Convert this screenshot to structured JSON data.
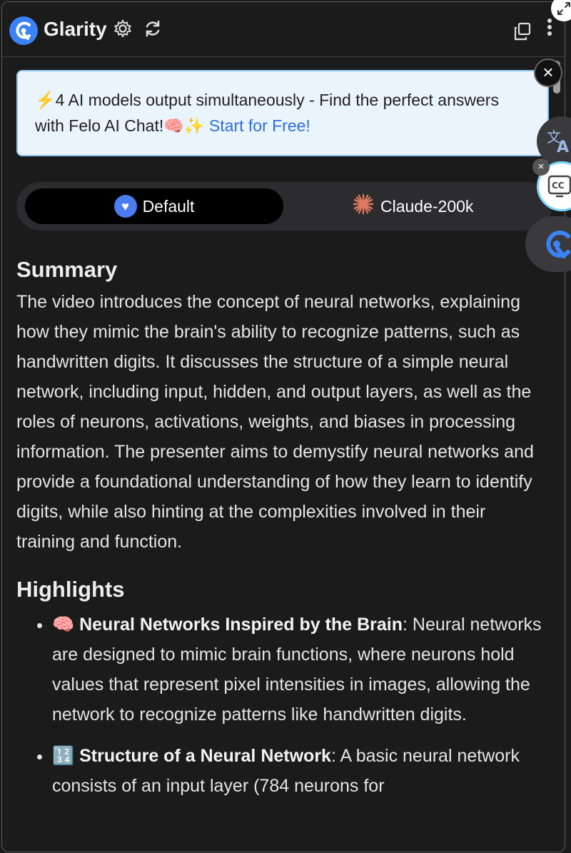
{
  "header": {
    "brand": "Glarity",
    "icons": [
      "glarity-logo-icon",
      "settings-gear-icon",
      "refresh-icon",
      "copy-icon",
      "more-vertical-icon"
    ]
  },
  "banner": {
    "text": "⚡4 AI models output simultaneously - Find the perfect answers with Felo AI Chat!🧠✨ ",
    "link": "Start for Free!"
  },
  "close_label": "×",
  "models": {
    "default_label": "Default",
    "claude_label": "Claude-200k",
    "selected": "Default"
  },
  "summary": {
    "title": "Summary",
    "text": "The video introduces the concept of neural networks, explaining how they mimic the brain's ability to recognize patterns, such as handwritten digits. It discusses the structure of a simple neural network, including input, hidden, and output layers, as well as the roles of neurons, activations, weights, and biases in processing information. The presenter aims to demystify neural networks and provide a foundational understanding of how they learn to identify digits, while also hinting at the complexities involved in their training and function."
  },
  "highlights": {
    "title": "Highlights",
    "items": [
      {
        "emoji": "🧠",
        "title": "Neural Networks Inspired by the Brain",
        "text": ": Neural networks are designed to mimic brain functions, where neurons hold values that represent pixel intensities in images, allowing the network to recognize patterns like handwritten digits."
      },
      {
        "emoji": "🔢",
        "title": "Structure of a Neural Network",
        "text": ": A basic neural network consists of an input layer (784 neurons for"
      }
    ]
  },
  "side_buttons": [
    "translate-icon",
    "closed-captions-icon",
    "glarity-side-icon"
  ],
  "colors": {
    "background": "#1b1b1c",
    "accent": "#3b82f6",
    "banner_bg": "#eaf4fd",
    "link": "#2f6fd6"
  }
}
